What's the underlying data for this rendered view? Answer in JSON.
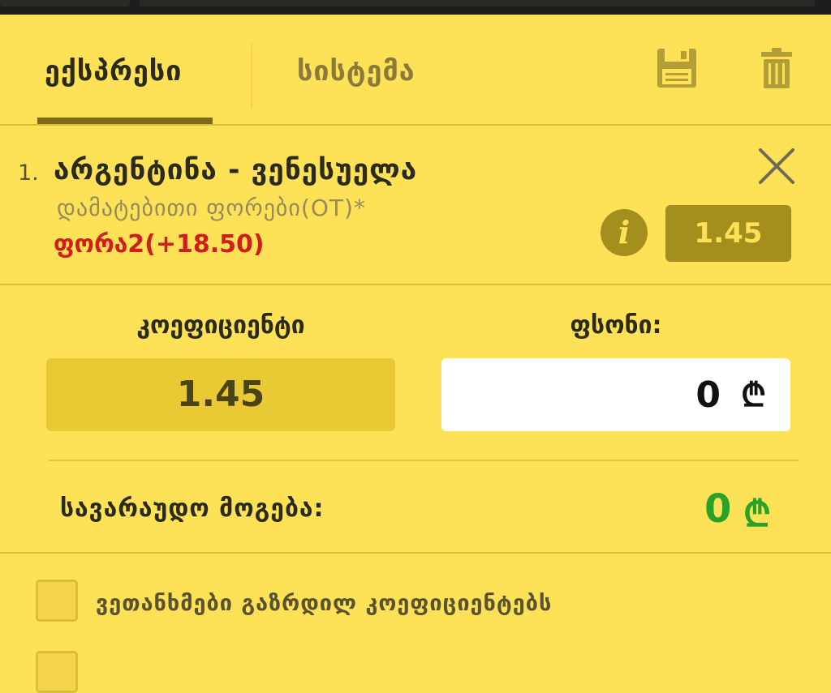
{
  "tabs": {
    "express": "ექსპრესი",
    "system": "სისტემა"
  },
  "toolbar": {
    "save_icon": "save-icon",
    "trash_icon": "trash-icon"
  },
  "selection": {
    "number": "1.",
    "match": "არგენტინა - ვენესუელა",
    "market": "დამატებითი ფორები(OT)*",
    "outcome": "ფორა2(+18.50)",
    "odd": "1.45",
    "info_icon": "i"
  },
  "coefficient": {
    "label": "კოეფიციენტი",
    "value": "1.45"
  },
  "stake": {
    "label": "ფსონი:",
    "value": "0",
    "currency": "₾"
  },
  "possible_win": {
    "label": "სავარაუდო მოგება:",
    "value": "0",
    "currency": "₾"
  },
  "options": {
    "accept_higher_odds": "ვეთანხმები გაზრდილ კოეფიციენტებს"
  },
  "colors": {
    "background": "#fde257",
    "accent_dark": "#a48f1e",
    "win_green": "#2aa228",
    "outcome_red": "#d11d1d"
  }
}
